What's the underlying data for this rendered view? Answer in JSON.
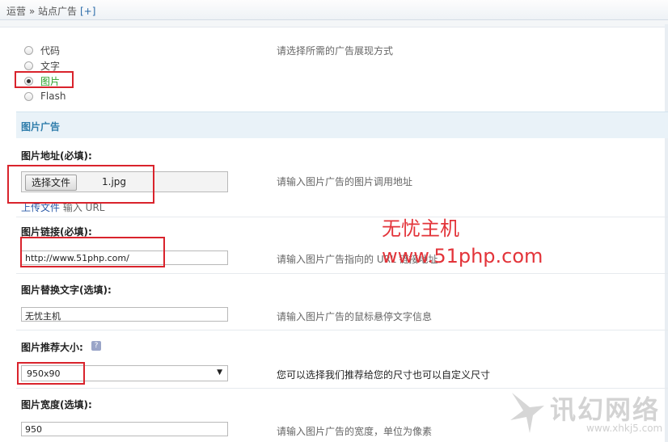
{
  "breadcrumb": {
    "text": "运营 » 站点广告",
    "plus": "[+]"
  },
  "display_type": {
    "options": [
      "代码",
      "文字",
      "图片",
      "Flash"
    ],
    "selected": "图片",
    "hint": "请选择所需的广告展现方式"
  },
  "section_title": "图片广告",
  "image_url": {
    "label": "图片地址(必填):",
    "button": "选择文件",
    "filename": "1.jpg",
    "hint": "请输入图片广告的图片调用地址",
    "upload_link": "上传文件",
    "upload_alt": "输入 URL"
  },
  "image_link": {
    "label": "图片链接(必填):",
    "value": "http://www.51php.com/",
    "hint": "请输入图片广告指向的 URL 链接地址"
  },
  "alt_text": {
    "label": "图片替换文字(选填):",
    "value": "无忧主机",
    "hint": "请输入图片广告的鼠标悬停文字信息"
  },
  "recommended_size": {
    "label": "图片推荐大小:",
    "help_icon": "help-icon",
    "value": "950x90",
    "hint": "您可以选择我们推荐给您的尺寸也可以自定义尺寸"
  },
  "width": {
    "label": "图片宽度(选填):",
    "value": "950",
    "hint": "请输入图片广告的宽度，单位为像素"
  },
  "watermark": {
    "line1": "无忧主机",
    "line2": "www.51php.com",
    "logo_text": "讯幻网络",
    "logo_url": "www.xhkj5.com"
  },
  "colors": {
    "annotation_red": "#d9232c",
    "section_blue": "#2f7dab",
    "selected_green": "#2aa02a"
  }
}
